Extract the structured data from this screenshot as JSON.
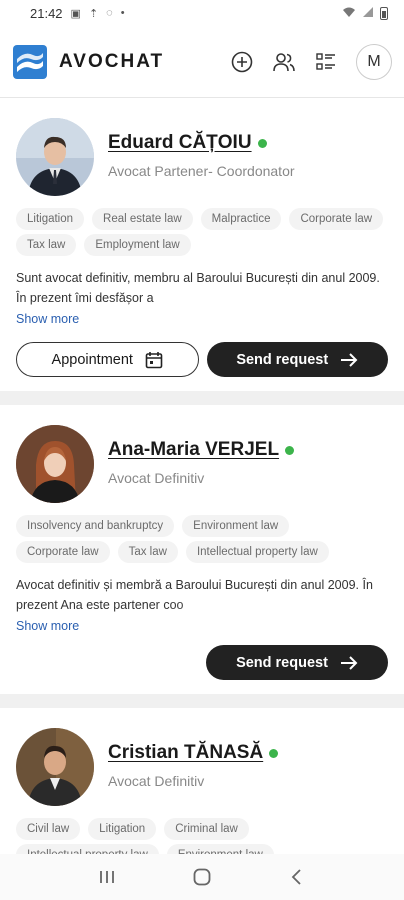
{
  "status_bar": {
    "time": "21:42"
  },
  "app_bar": {
    "brand": "AVOCHAT",
    "avatar_initial": "M",
    "icons": [
      "add-circle-icon",
      "users-icon",
      "list-icon"
    ]
  },
  "lawyers": [
    {
      "name": "Eduard CĂȚOIU",
      "online": true,
      "role": "Avocat Partener- Coordonator",
      "tags": [
        "Litigation",
        "Real estate law",
        "Malpractice",
        "Corporate law",
        "Tax law",
        "Employment law"
      ],
      "bio": "Sunt avocat definitiv, membru al Baroului București din anul 2009. În prezent îmi desfășor a",
      "show_more": "Show more",
      "appointment_label": "Appointment",
      "send_label": "Send request"
    },
    {
      "name": "Ana-Maria VERJEL",
      "online": true,
      "role": "Avocat Definitiv",
      "tags": [
        "Insolvency and bankruptcy",
        "Environment law",
        "Corporate law",
        "Tax law",
        "Intellectual property law"
      ],
      "bio": "Avocat definitiv și membră a Baroului București din anul 2009. În prezent Ana este partener coo",
      "show_more": "Show more",
      "send_label": "Send request"
    },
    {
      "name": "Cristian TĂNASĂ",
      "online": true,
      "role": "Avocat Definitiv",
      "tags": [
        "Civil law",
        "Litigation",
        "Criminal law",
        "Intellectual property law",
        "Environment law"
      ]
    }
  ],
  "colors": {
    "accent_dark": "#222222",
    "online": "#3cb44b",
    "link": "#2a5fb0",
    "logo_blue": "#2f7fd1"
  }
}
